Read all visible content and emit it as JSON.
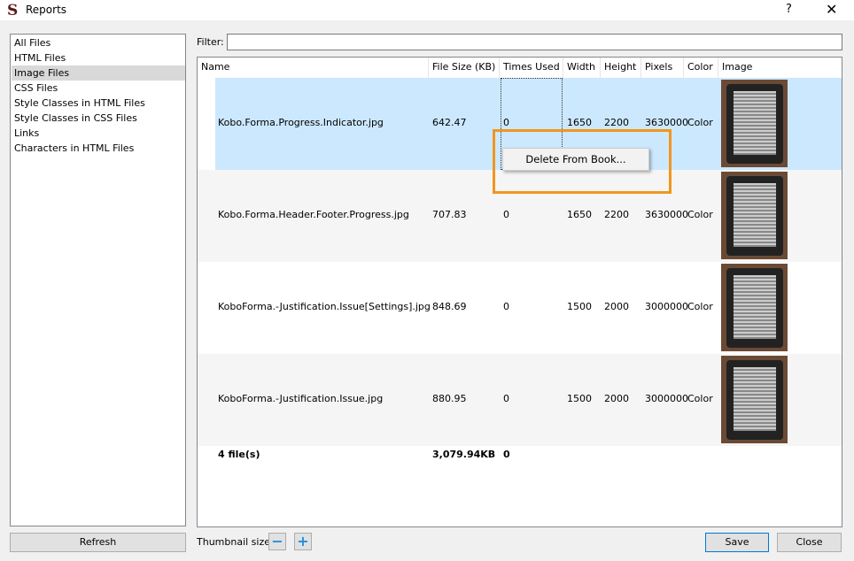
{
  "window": {
    "title": "Reports",
    "help": "?",
    "close": "✕"
  },
  "sidebar": {
    "items": [
      {
        "label": "All Files"
      },
      {
        "label": "HTML Files"
      },
      {
        "label": "Image Files",
        "selected": true
      },
      {
        "label": "CSS Files"
      },
      {
        "label": "Style Classes in HTML Files"
      },
      {
        "label": "Style Classes in CSS Files"
      },
      {
        "label": "Links"
      },
      {
        "label": "Characters in HTML Files"
      }
    ],
    "refresh": "Refresh"
  },
  "filter": {
    "label": "Filter:",
    "value": ""
  },
  "table": {
    "columns": [
      "Name",
      "File Size (KB)",
      "Times Used",
      "Width",
      "Height",
      "Pixels",
      "Color",
      "Image"
    ],
    "rows": [
      {
        "name": "Kobo.Forma.Progress.Indicator.jpg",
        "size": "642.47",
        "used": "0",
        "width": "1650",
        "height": "2200",
        "pixels": "3630000",
        "color": "Color"
      },
      {
        "name": "Kobo.Forma.Header.Footer.Progress.jpg",
        "size": "707.83",
        "used": "0",
        "width": "1650",
        "height": "2200",
        "pixels": "3630000",
        "color": "Color"
      },
      {
        "name": "KoboForma.-Justification.Issue[Settings].jpg",
        "size": "848.69",
        "used": "0",
        "width": "1500",
        "height": "2000",
        "pixels": "3000000",
        "color": "Color"
      },
      {
        "name": "KoboForma.-Justification.Issue.jpg",
        "size": "880.95",
        "used": "0",
        "width": "1500",
        "height": "2000",
        "pixels": "3000000",
        "color": "Color"
      }
    ],
    "totals": {
      "files": "4 file(s)",
      "size": "3,079.94KB",
      "used": "0"
    }
  },
  "context_menu": {
    "item": "Delete From Book..."
  },
  "footer": {
    "thumbnail_label": "Thumbnail size:",
    "minus": "−",
    "plus": "+",
    "save": "Save",
    "close": "Close"
  },
  "colors": {
    "selection": "#cce8ff",
    "highlight": "#f0961e"
  }
}
